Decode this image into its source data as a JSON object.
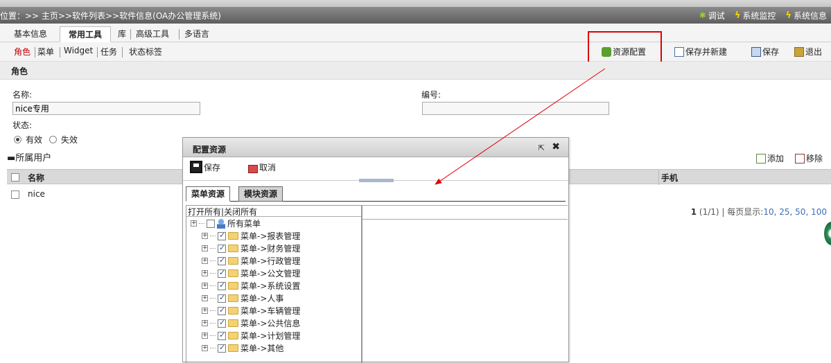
{
  "breadcrumb": "位置：>> 主页>>软件列表>>软件信息(OA办公管理系统)",
  "top_links": [
    {
      "label": "调试",
      "icon": "bug-icon"
    },
    {
      "label": "系统监控",
      "icon": "lightning-icon"
    },
    {
      "label": "系统信息",
      "icon": "lightning-icon"
    }
  ],
  "tabs": [
    "基本信息",
    "常用工具",
    "库",
    "高级工具",
    "多语言"
  ],
  "active_tab": "常用工具",
  "sub_tabs": [
    "角色",
    "菜单",
    "Widget",
    "任务",
    "状态标签"
  ],
  "active_sub_tab": "角色",
  "toolbar": {
    "resource_config": "资源配置",
    "save_new": "保存并新建",
    "save": "保存",
    "exit": "退出"
  },
  "section_title": "角色",
  "form": {
    "name_label": "名称:",
    "name_value": "nice专用",
    "code_label": "编号:",
    "code_value": "",
    "status_label": "状态:",
    "status_options": [
      "有效",
      "失效"
    ],
    "status_selected": "有效"
  },
  "users": {
    "title": "所属用户",
    "add_label": "添加",
    "remove_label": "移除",
    "columns": [
      "名称",
      "手机"
    ],
    "rows": [
      {
        "name": "nice"
      }
    ],
    "pager": {
      "current": "1",
      "summary": "(1/1)",
      "page_size_label": "每页显示:",
      "sizes": [
        "10",
        "25",
        "50",
        "100"
      ]
    }
  },
  "dialog": {
    "title": "配置资源",
    "save_label": "保存",
    "cancel_label": "取消",
    "tabs": [
      "菜单资源",
      "模块资源"
    ],
    "active_tab": "菜单资源",
    "tree": {
      "open_all": "打开所有",
      "close_all": "关闭所有",
      "root": "所有菜单",
      "items": [
        "菜单->报表管理",
        "菜单->财务管理",
        "菜单->行政管理",
        "菜单->公文管理",
        "菜单->系统设置",
        "菜单->人事",
        "菜单->车辆管理",
        "菜单->公共信息",
        "菜单->计划管理",
        "菜单->其他"
      ]
    }
  }
}
